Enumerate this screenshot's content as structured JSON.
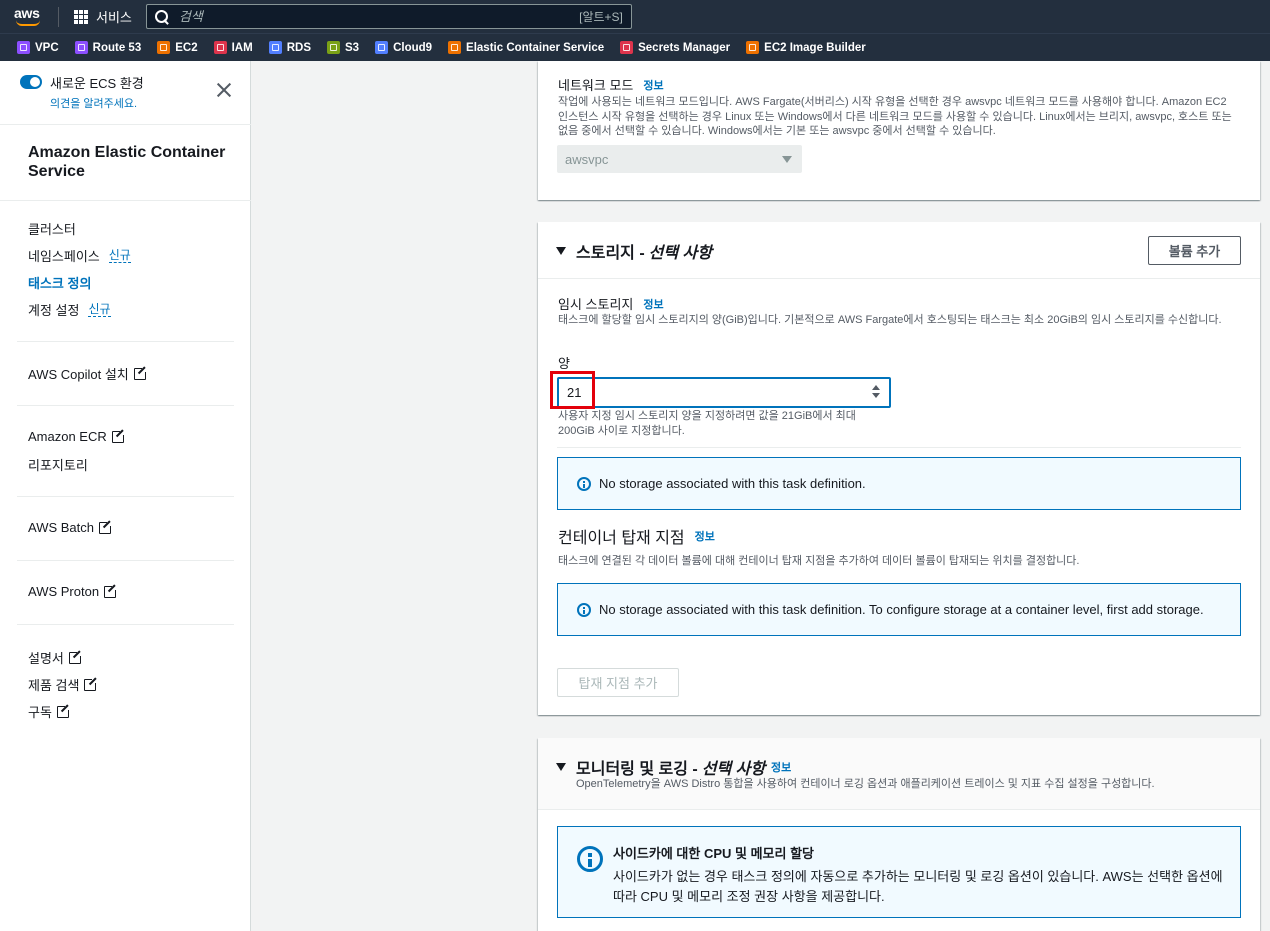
{
  "topbar": {
    "logo_text": "aws",
    "services_label": "서비스",
    "search_placeholder": "검색",
    "search_shortcut": "[알트+S]"
  },
  "favorites": [
    {
      "label": "VPC",
      "color": "#8c4fff"
    },
    {
      "label": "Route 53",
      "color": "#8c4fff"
    },
    {
      "label": "EC2",
      "color": "#ed7100"
    },
    {
      "label": "IAM",
      "color": "#dd344c"
    },
    {
      "label": "RDS",
      "color": "#527fff"
    },
    {
      "label": "S3",
      "color": "#7aa116"
    },
    {
      "label": "Cloud9",
      "color": "#527fff"
    },
    {
      "label": "Elastic Container Service",
      "color": "#ed7100"
    },
    {
      "label": "Secrets Manager",
      "color": "#dd344c"
    },
    {
      "label": "EC2 Image Builder",
      "color": "#ed7100"
    }
  ],
  "sidebar": {
    "new_ecs_label": "새로운 ECS 환경",
    "feedback_link": "의견을 알려주세요.",
    "service_title": "Amazon Elastic Container Service",
    "nav": [
      {
        "label": "클러스터"
      },
      {
        "label": "네임스페이스",
        "badge": "신규"
      },
      {
        "label": "태스크 정의"
      },
      {
        "label": "계정 설정",
        "badge": "신규"
      }
    ],
    "copilot": "AWS Copilot 설치",
    "ecr": "Amazon ECR",
    "repositories": "리포지토리",
    "batch": "AWS Batch",
    "proton": "AWS Proton",
    "docs": "설명서",
    "product_search": "제품 검색",
    "subscribe": "구독"
  },
  "network": {
    "label": "네트워크 모드",
    "info": "정보",
    "description": "작업에 사용되는 네트워크 모드입니다. AWS Fargate(서버리스) 시작 유형을 선택한 경우 awsvpc 네트워크 모드를 사용해야 합니다. Amazon EC2 인스턴스 시작 유형을 선택하는 경우 Linux 또는 Windows에서 다른 네트워크 모드를 사용할 수 있습니다. Linux에서는 브리지, awsvpc, 호스트 또는 없음 중에서 선택할 수 있습니다. Windows에서는 기본 또는 awsvpc 중에서 선택할 수 있습니다.",
    "selected": "awsvpc"
  },
  "storage": {
    "title": "스토리지 -",
    "optional": "선택 사항",
    "add_volume_button": "볼륨 추가",
    "ephemeral_label": "임시 스토리지",
    "info": "정보",
    "ephemeral_desc": "태스크에 할당할 임시 스토리지의 양(GiB)입니다. 기본적으로 AWS Fargate에서 호스팅되는 태스크는 최소 20GiB의 임시 스토리지를 수신합니다.",
    "amount_label": "양",
    "amount_value": "21",
    "amount_hint": "사용자 지정 임시 스토리지 양을 지정하려면 값을 21GiB에서 최대 200GiB 사이로 지정합니다.",
    "no_storage_msg": "No storage associated with this task definition.",
    "mount_title": "컨테이너 탑재 지점",
    "mount_info": "정보",
    "mount_desc": "태스크에 연결된 각 데이터 볼륨에 대해 컨테이너 탑재 지점을 추가하여 데이터 볼륨이 탑재되는 위치를 결정합니다.",
    "mount_no_storage_msg": "No storage associated with this task definition. To configure storage at a container level, first add storage.",
    "add_mount_button": "탑재 지점 추가"
  },
  "monitoring": {
    "title": "모니터링 및 로깅 -",
    "optional": "선택 사항",
    "info": "정보",
    "description": "OpenTelemetry을 AWS Distro 통합을 사용하여 컨테이너 로깅 옵션과 애플리케이션 트레이스 및 지표 수집 설정을 구성합니다.",
    "sidecar_title": "사이드카에 대한 CPU 및 메모리 할당",
    "sidecar_desc": "사이드카가 없는 경우 태스크 정의에 자동으로 추가하는 모니터링 및 로깅 옵션이 있습니다. AWS는 선택한 옵션에 따라 CPU 및 메모리 조정 권장 사항을 제공합니다."
  }
}
